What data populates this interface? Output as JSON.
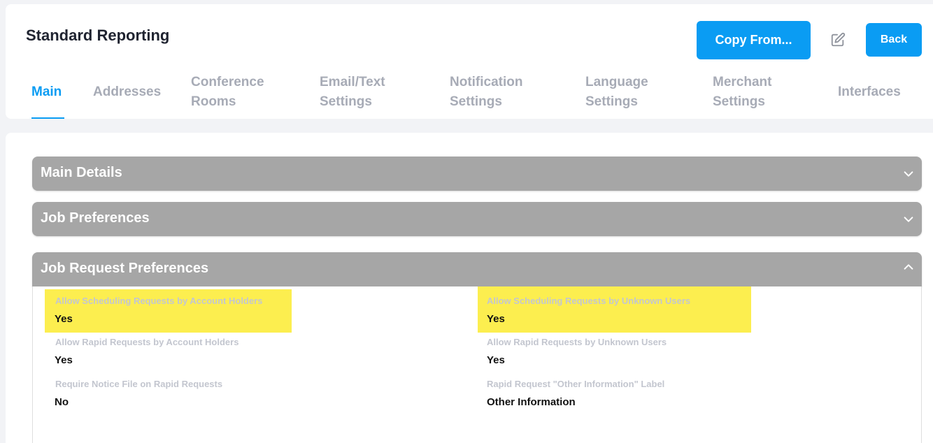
{
  "header": {
    "title": "Standard Reporting",
    "copy_from_label": "Copy From...",
    "back_label": "Back"
  },
  "tabs": [
    {
      "label": "Main",
      "active": true
    },
    {
      "label": "Addresses"
    },
    {
      "label": "Conference Rooms"
    },
    {
      "label": "Email/Text Settings"
    },
    {
      "label": "Notification Settings"
    },
    {
      "label": "Language Settings"
    },
    {
      "label": "Merchant Settings"
    },
    {
      "label": "Interfaces"
    }
  ],
  "sections": [
    {
      "title": "Main Details",
      "expanded": false
    },
    {
      "title": "Job Preferences",
      "expanded": false
    },
    {
      "title": "Job Request Preferences",
      "expanded": true
    }
  ],
  "fields": [
    {
      "label": "Allow Scheduling Requests by Account Holders",
      "value": "Yes",
      "highlighted": true
    },
    {
      "label": "Allow Scheduling Requests by Unknown Users",
      "value": "Yes",
      "highlighted": true
    },
    {
      "label": "Allow Rapid Requests by Account Holders",
      "value": "Yes"
    },
    {
      "label": "Allow Rapid Requests by Unknown Users",
      "value": "Yes"
    },
    {
      "label": "Require Notice File on Rapid Requests",
      "value": "No"
    },
    {
      "label": "Rapid Request \"Other Information\" Label",
      "value": "Other Information"
    }
  ],
  "colors": {
    "accent": "#0a9cf3",
    "accordion": "#a6a6a6",
    "highlight": "#fcee4f"
  },
  "icons": {
    "edit": "pencil-square-icon",
    "collapsed": "chevron-down-icon",
    "expanded": "chevron-up-icon"
  }
}
